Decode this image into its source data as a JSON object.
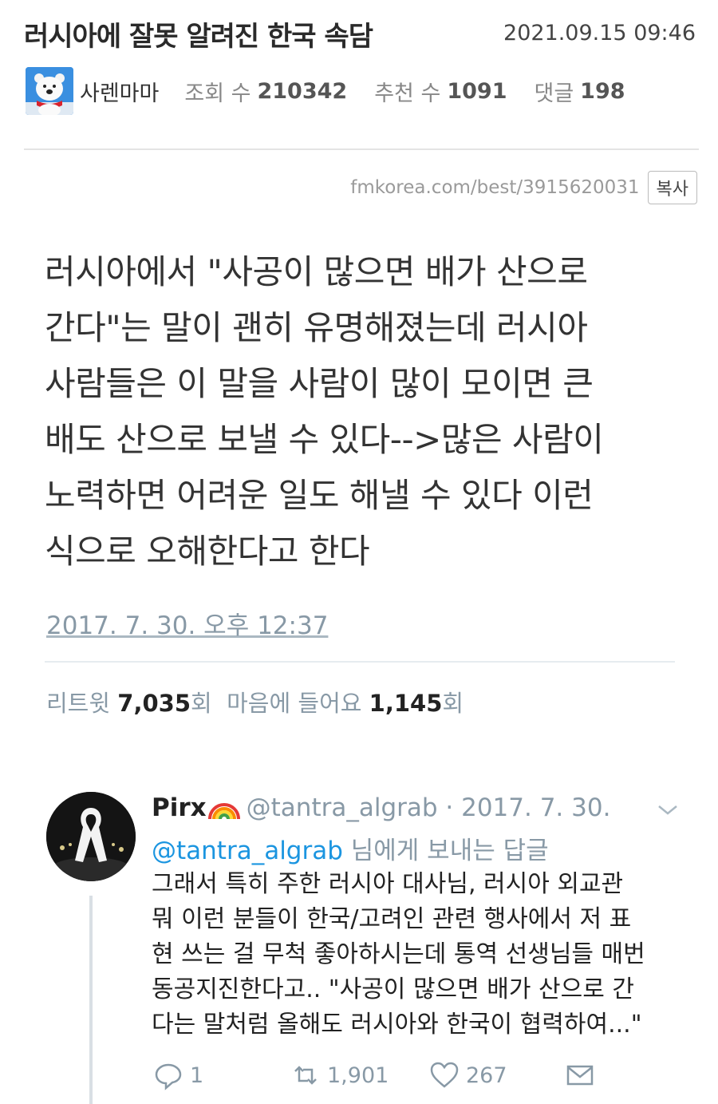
{
  "post": {
    "title": "러시아에 잘못 알려진 한국 속담",
    "date": "2021.09.15 09:46",
    "author": "사렌마마",
    "views_label": "조회 수",
    "views": "210342",
    "recommend_label": "추천 수",
    "recommend": "1091",
    "comments_label": "댓글",
    "comments": "198",
    "url": "fmkorea.com/best/3915620031",
    "copy_label": "복사"
  },
  "tweet": {
    "lines": [
      "러시아에서 \"사공이 많으면 배가 산으로",
      "간다\"는 말이 괜히 유명해졌는데 러시아",
      "사람들은 이 말을 사람이 많이 모이면 큰",
      "배도 산으로 보낼 수 있다-->많은 사람이",
      "노력하면 어려운 일도 해낼 수 있다 이런",
      "식으로 오해한다고 한다"
    ],
    "timestamp": "2017. 7. 30. 오후 12:37",
    "retweet_label": "리트윗",
    "retweets": "7,035",
    "retweet_unit": "회",
    "like_label": "마음에 들어요",
    "likes": "1,145",
    "like_unit": "회"
  },
  "reply": {
    "name": "Pirx",
    "handle_date": "@tantra_algrab · 2017. 7. 30.",
    "reply_to_mention": "@tantra_algrab",
    "reply_to_suffix": " 님에게 보내는 답글",
    "lines": [
      "그래서 특히 주한 러시아 대사님, 러시아 외교관",
      "뭐 이런 분들이 한국/고려인 관련 행사에서 저 표",
      "현 쓰는 걸 무척 좋아하시는데 통역 선생님들 매번",
      "동공지진한다고.. \"사공이 많으면 배가 산으로 간",
      "다는 말처럼 올해도 러시아와 한국이 협력하여...\""
    ],
    "replies": "1",
    "retweets": "1,901",
    "likes": "267"
  },
  "icons": {
    "avatar": "polar-bear-avatar",
    "rainbow": "rainbow-emoji",
    "chevron": "chevron-down-icon",
    "reply": "reply-icon",
    "retweet": "retweet-icon",
    "like": "heart-icon",
    "message": "envelope-icon"
  },
  "colors": {
    "link_blue": "#1b95e0",
    "muted_gray": "#8899a6",
    "avatar_bg": "#3a8fe0"
  }
}
